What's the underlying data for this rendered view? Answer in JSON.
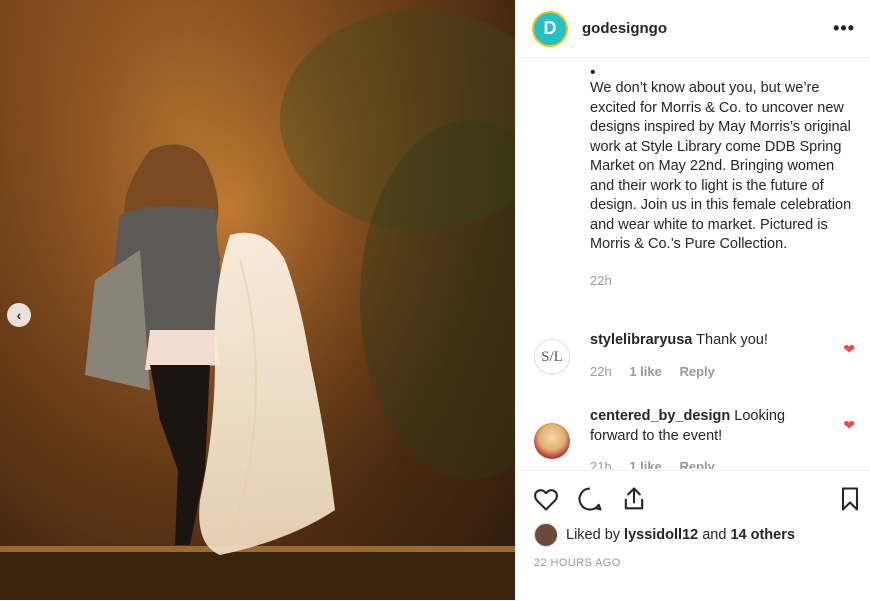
{
  "post": {
    "username": "godesigngo",
    "avatar_letter": "D",
    "more_icon": "•••",
    "caption_bullet": "•",
    "caption": "We don’t know about you, but we’re excited for Morris & Co. to uncover new designs inspired by May Morris’s original work at Style Library come DDB Spring Market on May 22nd. Bringing women and their work to light is the future of design. Join us in this female celebration and wear white to market. Pictured is Morris & Co.’s Pure Collection.",
    "caption_time": "22h",
    "prev_icon": "‹"
  },
  "comments": [
    {
      "username": "stylelibraryusa",
      "text": "Thank you!",
      "time": "22h",
      "likes": "1 like",
      "reply": "Reply",
      "avatar_text": "S/L"
    },
    {
      "username": "centered_by_design",
      "text": "Looking forward to the event!",
      "time": "21h",
      "likes": "1 like",
      "reply": "Reply"
    }
  ],
  "likes": {
    "prefix": "Liked by ",
    "user": "lyssidoll12",
    "middle": " and ",
    "others": "14 others"
  },
  "post_time": "22 HOURS AGO",
  "colors": {
    "accent_teal": "#23c1c7",
    "heart_red": "#ed4956",
    "muted": "#999999",
    "text": "#262626"
  }
}
